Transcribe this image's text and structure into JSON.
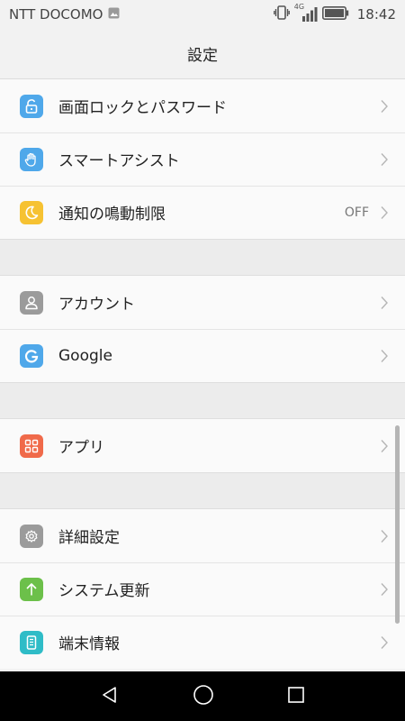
{
  "status_bar": {
    "carrier": "NTT DOCOMO",
    "network": "4G",
    "time": "18:42"
  },
  "header": {
    "title": "設定"
  },
  "groups": [
    {
      "items": [
        {
          "label": "画面ロックとパスワード",
          "icon": "lock-icon",
          "color": "#4fa8ea"
        },
        {
          "label": "スマートアシスト",
          "icon": "hand-icon",
          "color": "#4fa8ea"
        },
        {
          "label": "通知の鳴動制限",
          "icon": "moon-icon",
          "color": "#f6c232",
          "value": "OFF"
        }
      ]
    },
    {
      "items": [
        {
          "label": "アカウント",
          "icon": "user-icon",
          "color": "#9b9b9b"
        },
        {
          "label": "Google",
          "icon": "google-icon",
          "color": "#4fa8ea"
        }
      ]
    },
    {
      "items": [
        {
          "label": "アプリ",
          "icon": "apps-icon",
          "color": "#f06a4a"
        }
      ]
    },
    {
      "items": [
        {
          "label": "詳細設定",
          "icon": "gear-icon",
          "color": "#9b9b9b"
        },
        {
          "label": "システム更新",
          "icon": "update-icon",
          "color": "#6cc04a"
        },
        {
          "label": "端末情報",
          "icon": "phone-info-icon",
          "color": "#2fbcc7"
        }
      ]
    }
  ]
}
